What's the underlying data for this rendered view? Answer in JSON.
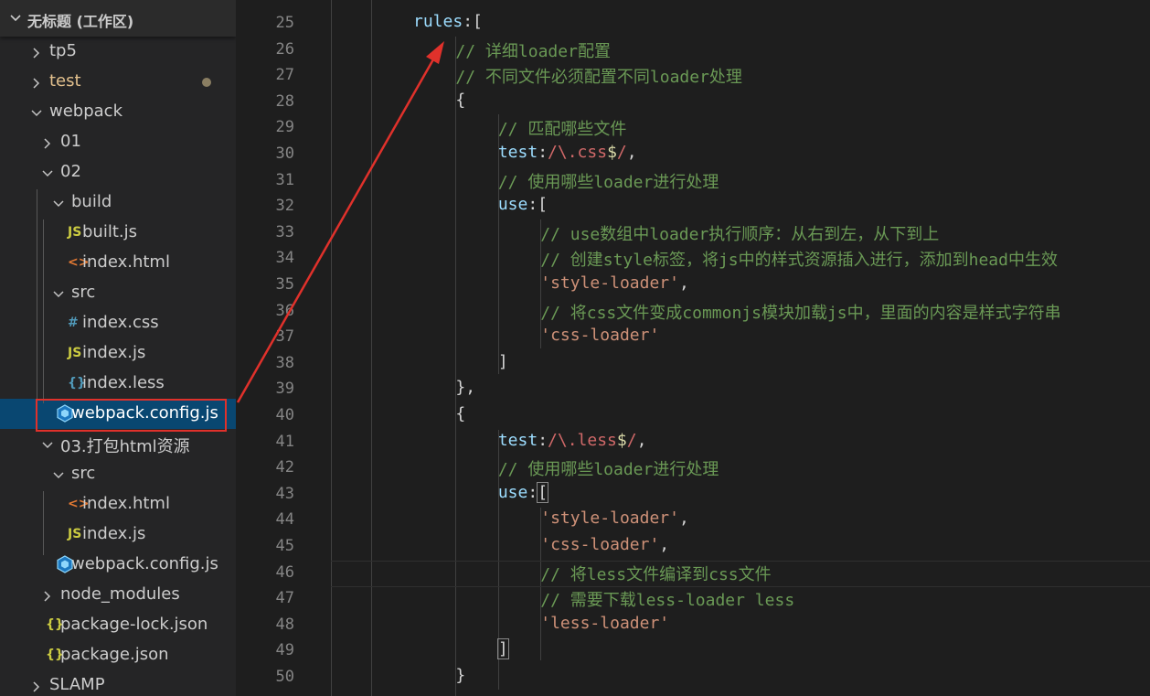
{
  "workspace_title": "无标题 (工作区)",
  "explorer": [
    {
      "label": "tp5",
      "kind": "folder",
      "open": false,
      "depth": 0,
      "color": "#cccccc"
    },
    {
      "label": "test",
      "kind": "folder",
      "open": false,
      "depth": 0,
      "color": "#e2c08d",
      "modified": true
    },
    {
      "label": "webpack",
      "kind": "folder",
      "open": true,
      "depth": 0,
      "color": "#cccccc"
    },
    {
      "label": "01",
      "kind": "folder",
      "open": false,
      "depth": 1,
      "color": "#cccccc"
    },
    {
      "label": "02",
      "kind": "folder",
      "open": true,
      "depth": 1,
      "color": "#cccccc"
    },
    {
      "label": "build",
      "kind": "folder",
      "open": true,
      "depth": 2,
      "color": "#cccccc"
    },
    {
      "label": "built.js",
      "kind": "js",
      "depth": 3,
      "color": "#cccccc",
      "icon_text": "JS",
      "icon_color": "#cbcb41"
    },
    {
      "label": "index.html",
      "kind": "html",
      "depth": 3,
      "color": "#cccccc",
      "icon_text": "<>",
      "icon_color": "#e37933"
    },
    {
      "label": "src",
      "kind": "folder",
      "open": true,
      "depth": 2,
      "color": "#cccccc"
    },
    {
      "label": "index.css",
      "kind": "css",
      "depth": 3,
      "color": "#cccccc",
      "icon_text": "#",
      "icon_color": "#519aba"
    },
    {
      "label": "index.js",
      "kind": "js",
      "depth": 3,
      "color": "#cccccc",
      "icon_text": "JS",
      "icon_color": "#cbcb41"
    },
    {
      "label": "index.less",
      "kind": "less",
      "depth": 3,
      "color": "#cccccc",
      "icon_text": "{}",
      "icon_color": "#519aba"
    },
    {
      "label": "webpack.config.js",
      "kind": "webpack",
      "depth": 2,
      "color": "#ffffff",
      "selected": true,
      "icon_color": "#8ed6fb"
    },
    {
      "label": "03.打包html资源",
      "kind": "folder",
      "open": true,
      "depth": 1,
      "color": "#cccccc"
    },
    {
      "label": "src",
      "kind": "folder",
      "open": true,
      "depth": 2,
      "color": "#cccccc"
    },
    {
      "label": "index.html",
      "kind": "html",
      "depth": 3,
      "color": "#cccccc",
      "icon_text": "<>",
      "icon_color": "#e37933"
    },
    {
      "label": "index.js",
      "kind": "js",
      "depth": 3,
      "color": "#cccccc",
      "icon_text": "JS",
      "icon_color": "#cbcb41"
    },
    {
      "label": "webpack.config.js",
      "kind": "webpack",
      "depth": 2,
      "color": "#cccccc",
      "icon_color": "#8ed6fb"
    },
    {
      "label": "node_modules",
      "kind": "folder",
      "open": false,
      "depth": 1,
      "color": "#cccccc"
    },
    {
      "label": "package-lock.json",
      "kind": "json",
      "depth": 1,
      "color": "#cccccc",
      "icon_text": "{}",
      "icon_color": "#cbcb41"
    },
    {
      "label": "package.json",
      "kind": "json",
      "depth": 1,
      "color": "#cccccc",
      "icon_text": "{}",
      "icon_color": "#cbcb41"
    },
    {
      "label": "SLAMP",
      "kind": "folder",
      "open": false,
      "depth": 0,
      "color": "#cccccc"
    }
  ],
  "code_lines": [
    {
      "num": "25",
      "indent": 4,
      "tokens": [
        [
          "var",
          "rules"
        ],
        [
          "pun",
          ":["
        ]
      ]
    },
    {
      "num": "26",
      "indent": 5,
      "tokens": [
        [
          "com",
          "// 详细loader配置"
        ]
      ]
    },
    {
      "num": "27",
      "indent": 5,
      "tokens": [
        [
          "com",
          "// 不同文件必须配置不同loader处理"
        ]
      ]
    },
    {
      "num": "28",
      "indent": 5,
      "tokens": [
        [
          "pun",
          "{"
        ]
      ]
    },
    {
      "num": "29",
      "indent": 6,
      "tokens": [
        [
          "com",
          "// 匹配哪些文件"
        ]
      ]
    },
    {
      "num": "30",
      "indent": 6,
      "tokens": [
        [
          "var",
          "test"
        ],
        [
          "pun",
          ":"
        ],
        [
          "re",
          "/\\.css"
        ],
        [
          "dol",
          "$"
        ],
        [
          "re",
          "/"
        ],
        [
          "pun",
          ","
        ]
      ]
    },
    {
      "num": "31",
      "indent": 6,
      "tokens": [
        [
          "com",
          "// 使用哪些loader进行处理"
        ]
      ]
    },
    {
      "num": "32",
      "indent": 6,
      "tokens": [
        [
          "var",
          "use"
        ],
        [
          "pun",
          ":["
        ]
      ]
    },
    {
      "num": "33",
      "indent": 7,
      "tokens": [
        [
          "com",
          "// use数组中loader执行顺序：从右到左，从下到上"
        ]
      ]
    },
    {
      "num": "34",
      "indent": 7,
      "tokens": [
        [
          "com",
          "// 创建style标签，将js中的样式资源插入进行，添加到head中生效"
        ]
      ]
    },
    {
      "num": "35",
      "indent": 7,
      "tokens": [
        [
          "str",
          "'style-loader'"
        ],
        [
          "pun",
          ","
        ]
      ]
    },
    {
      "num": "36",
      "indent": 7,
      "tokens": [
        [
          "com",
          "// 将css文件变成commonjs模块加载js中，里面的内容是样式字符串"
        ]
      ]
    },
    {
      "num": "37",
      "indent": 7,
      "tokens": [
        [
          "str",
          "'css-loader'"
        ]
      ]
    },
    {
      "num": "38",
      "indent": 6,
      "tokens": [
        [
          "pun",
          "]"
        ]
      ]
    },
    {
      "num": "39",
      "indent": 5,
      "tokens": [
        [
          "pun",
          "},"
        ]
      ]
    },
    {
      "num": "40",
      "indent": 5,
      "tokens": [
        [
          "pun",
          "{"
        ]
      ]
    },
    {
      "num": "41",
      "indent": 6,
      "tokens": [
        [
          "var",
          "test"
        ],
        [
          "pun",
          ":"
        ],
        [
          "re",
          "/\\.less"
        ],
        [
          "dol",
          "$"
        ],
        [
          "re",
          "/"
        ],
        [
          "pun",
          ","
        ]
      ]
    },
    {
      "num": "42",
      "indent": 6,
      "tokens": [
        [
          "com",
          "// 使用哪些loader进行处理"
        ]
      ]
    },
    {
      "num": "43",
      "indent": 6,
      "tokens": [
        [
          "var",
          "use"
        ],
        [
          "pun",
          ":"
        ],
        [
          "box",
          "["
        ]
      ]
    },
    {
      "num": "44",
      "indent": 7,
      "tokens": [
        [
          "str",
          "'style-loader'"
        ],
        [
          "pun",
          ","
        ]
      ]
    },
    {
      "num": "45",
      "indent": 7,
      "tokens": [
        [
          "str",
          "'css-loader'"
        ],
        [
          "pun",
          ","
        ]
      ]
    },
    {
      "num": "46",
      "indent": 7,
      "tokens": [
        [
          "com",
          "// 将less文件编译到css文件"
        ]
      ]
    },
    {
      "num": "47",
      "indent": 7,
      "tokens": [
        [
          "com",
          "// 需要下载less-loader less"
        ]
      ]
    },
    {
      "num": "48",
      "indent": 7,
      "tokens": [
        [
          "str",
          "'less-loader'"
        ]
      ]
    },
    {
      "num": "49",
      "indent": 6,
      "tokens": [
        [
          "box",
          "]"
        ]
      ]
    },
    {
      "num": "50",
      "indent": 5,
      "tokens": [
        [
          "pun",
          "}"
        ]
      ]
    }
  ],
  "colors": {
    "comment": "#6a9955",
    "string": "#ce9178",
    "property": "#9cdcfe",
    "regex": "#d16969",
    "annotation_red": "#e0312b",
    "selection": "#094771"
  }
}
